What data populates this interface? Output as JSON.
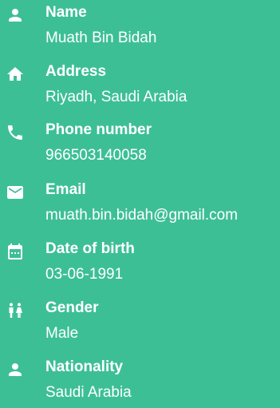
{
  "profile": {
    "fields": [
      {
        "icon": "person-icon",
        "label": "Name",
        "value": "Muath Bin Bidah"
      },
      {
        "icon": "home-icon",
        "label": "Address",
        "value": "Riyadh, Saudi Arabia"
      },
      {
        "icon": "phone-icon",
        "label": "Phone number",
        "value": "966503140058"
      },
      {
        "icon": "mail-icon",
        "label": "Email",
        "value": "muath.bin.bidah@gmail.com"
      },
      {
        "icon": "calendar-icon",
        "label": "Date of birth",
        "value": "03-06-1991"
      },
      {
        "icon": "gender-icon",
        "label": "Gender",
        "value": "Male"
      },
      {
        "icon": "person-icon",
        "label": "Nationality",
        "value": "Saudi Arabia"
      }
    ]
  }
}
